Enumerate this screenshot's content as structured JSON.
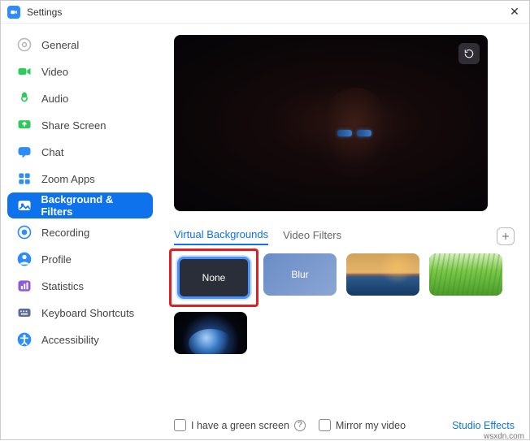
{
  "window": {
    "title": "Settings"
  },
  "sidebar": {
    "items": [
      {
        "label": "General"
      },
      {
        "label": "Video"
      },
      {
        "label": "Audio"
      },
      {
        "label": "Share Screen"
      },
      {
        "label": "Chat"
      },
      {
        "label": "Zoom Apps"
      },
      {
        "label": "Background & Filters"
      },
      {
        "label": "Recording"
      },
      {
        "label": "Profile"
      },
      {
        "label": "Statistics"
      },
      {
        "label": "Keyboard Shortcuts"
      },
      {
        "label": "Accessibility"
      }
    ],
    "active_index": 6
  },
  "tabs": {
    "virtual_backgrounds": "Virtual Backgrounds",
    "video_filters": "Video Filters",
    "active": "virtual_backgrounds"
  },
  "backgrounds": {
    "none_label": "None",
    "blur_label": "Blur",
    "selected": "none"
  },
  "footer": {
    "green_screen_label": "I have a green screen",
    "mirror_label": "Mirror my video",
    "studio_effects_label": "Studio Effects"
  },
  "watermark": "wsxdn.com",
  "colors": {
    "accent": "#0E72ED",
    "highlight_red": "#e02020"
  }
}
